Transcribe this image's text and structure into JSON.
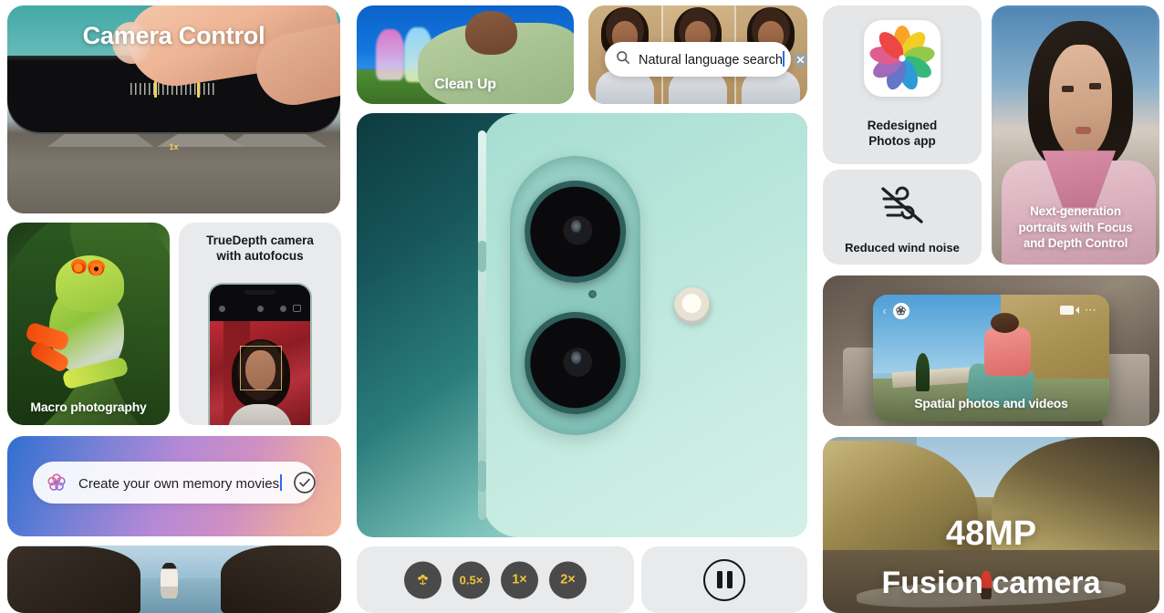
{
  "collage": {
    "title": "iPhone camera features collage",
    "background": "#ffffff"
  },
  "panels": {
    "camera_control": {
      "title": "Camera Control",
      "zoom_label": "1x",
      "icon": "finger-tap-icon"
    },
    "macro": {
      "caption": "Macro photography"
    },
    "truedepth": {
      "heading_line1": "TrueDepth camera",
      "heading_line2": "with autofocus"
    },
    "memory_movies": {
      "value": "Create your own memory movies",
      "placeholder": "Create your own memory movies",
      "ai_icon": "apple-intelligence-icon",
      "submit_icon": "check-circle-icon"
    },
    "beach": {
      "caption": ""
    },
    "clean_up": {
      "caption": "Clean Up"
    },
    "natural_language_search": {
      "value": "Natural language search",
      "placeholder": "Natural language search",
      "search_icon": "search-icon",
      "clear_icon": "clear-circle-icon"
    },
    "hero": {
      "alt": "iPhone 16 rear camera module in teal"
    },
    "zoom_controls": {
      "buttons": [
        {
          "id": "macro",
          "label": "",
          "icon": "flower-macro-icon"
        },
        {
          "id": "0.5x",
          "label": "0.5×",
          "icon": ""
        },
        {
          "id": "1x",
          "label": "1×",
          "icon": ""
        },
        {
          "id": "2x",
          "label": "2×",
          "icon": ""
        }
      ],
      "accent_color": "#f2c33c",
      "button_color": "#4a4a4a"
    },
    "pause": {
      "icon": "pause-circle-icon"
    },
    "photos_app": {
      "label_line1": "Redesigned",
      "label_line2": "Photos app",
      "icon": "apple-photos-icon"
    },
    "wind_noise": {
      "label": "Reduced wind noise",
      "icon": "wind-slash-icon"
    },
    "portraits": {
      "caption_line1": "Next-generation",
      "caption_line2": "portraits with Focus",
      "caption_line3": "and Depth Control"
    },
    "spatial": {
      "caption": "Spatial photos and videos",
      "back_icon": "chevron-left-icon",
      "ai_icon": "apple-intelligence-icon",
      "video_icon": "video-camera-icon",
      "more_icon": "more-dots-icon"
    },
    "fusion_camera": {
      "line1": "48MP",
      "line2": "Fusion camera"
    }
  }
}
